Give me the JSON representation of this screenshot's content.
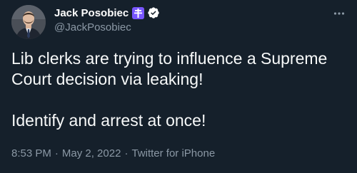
{
  "author": {
    "display_name": "Jack Posobiec",
    "handle": "@JackPosobiec",
    "badges": [
      "cross-badge-icon",
      "verified-badge-icon"
    ]
  },
  "tweet": {
    "lines": [
      "Lib clerks are trying to influence a Supreme Court decision via leaking!",
      "Identify and arrest at once!"
    ]
  },
  "meta": {
    "time": "8:53 PM",
    "separator": "·",
    "date": "May 2, 2022",
    "source": "Twitter for iPhone"
  },
  "colors": {
    "background": "#15202b",
    "text": "#f7f9f9",
    "secondary": "#8b98a5",
    "verified": "#ffffff",
    "cross_badge": "#7856ff"
  }
}
